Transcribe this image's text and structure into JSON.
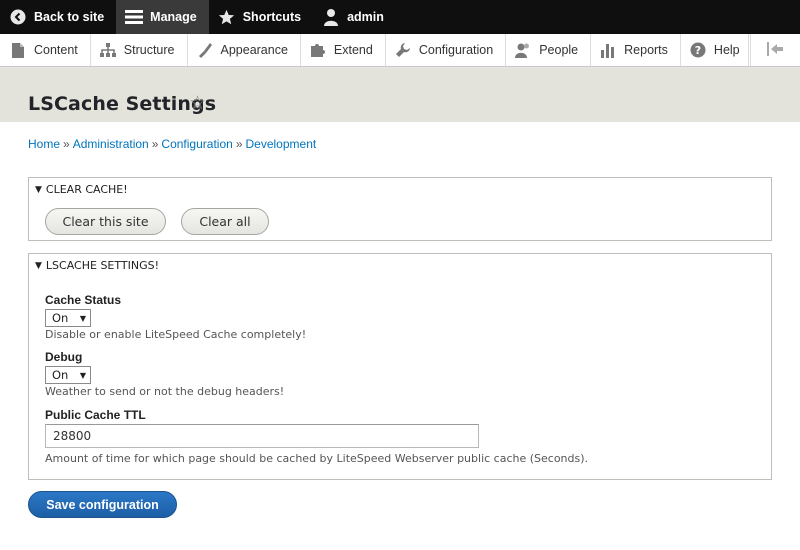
{
  "toolbar": {
    "back": "Back to site",
    "manage": "Manage",
    "shortcuts": "Shortcuts",
    "user": "admin"
  },
  "tray": {
    "items": [
      "Content",
      "Structure",
      "Appearance",
      "Extend",
      "Configuration",
      "People",
      "Reports",
      "Help"
    ]
  },
  "page": {
    "title": "LSCache Settings"
  },
  "breadcrumb": {
    "items": [
      "Home",
      "Administration",
      "Configuration",
      "Development"
    ],
    "separator": "»"
  },
  "clear_cache": {
    "summary": "CLEAR CACHE!",
    "clear_site_label": "Clear this site",
    "clear_all_label": "Clear all"
  },
  "settings": {
    "summary": "LSCACHE SETTINGS!",
    "cache_status": {
      "label": "Cache Status",
      "value": "On",
      "description": "Disable or enable LiteSpeed Cache completely!"
    },
    "debug": {
      "label": "Debug",
      "value": "On",
      "description": "Weather to send or not the debug headers!"
    },
    "public_ttl": {
      "label": "Public Cache TTL",
      "value": "28800",
      "description": "Amount of time for which page should be cached by LiteSpeed Webserver public cache (Seconds)."
    }
  },
  "actions": {
    "save_label": "Save configuration"
  },
  "colors": {
    "link": "#0074bd",
    "primary": "#1f68b2",
    "toolbar": "#0f0f0f",
    "title_band": "#e3e3dc"
  }
}
